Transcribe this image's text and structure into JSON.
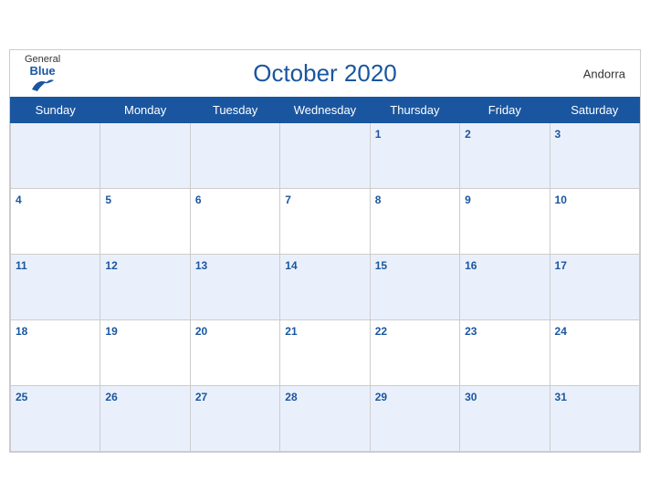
{
  "header": {
    "title": "October 2020",
    "country": "Andorra",
    "logo_general": "General",
    "logo_blue": "Blue"
  },
  "days_of_week": [
    "Sunday",
    "Monday",
    "Tuesday",
    "Wednesday",
    "Thursday",
    "Friday",
    "Saturday"
  ],
  "weeks": [
    [
      null,
      null,
      null,
      null,
      1,
      2,
      3
    ],
    [
      4,
      5,
      6,
      7,
      8,
      9,
      10
    ],
    [
      11,
      12,
      13,
      14,
      15,
      16,
      17
    ],
    [
      18,
      19,
      20,
      21,
      22,
      23,
      24
    ],
    [
      25,
      26,
      27,
      28,
      29,
      30,
      31
    ]
  ]
}
